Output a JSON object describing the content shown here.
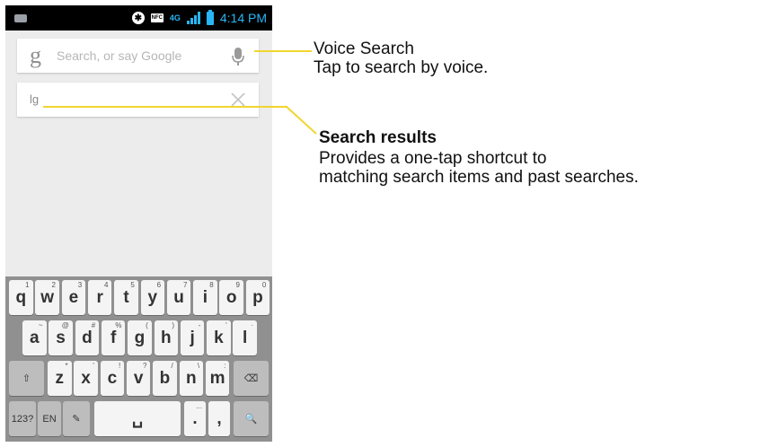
{
  "status_bar": {
    "time": "4:14 PM",
    "nfc_label": "NFC",
    "network_label": "4G",
    "bluetooth_glyph": "✱",
    "icons": [
      "keyboard-icon",
      "bluetooth-icon",
      "nfc-icon",
      "4g-icon",
      "signal-icon",
      "battery-icon"
    ]
  },
  "search": {
    "logo": "g",
    "placeholder": "Search, or say Google",
    "voice_icon": "microphone-icon"
  },
  "query": {
    "text": "lg",
    "clear_icon": "close-icon"
  },
  "keyboard": {
    "row1": [
      {
        "label": "q",
        "sup": "1"
      },
      {
        "label": "w",
        "sup": "2"
      },
      {
        "label": "e",
        "sup": "3"
      },
      {
        "label": "r",
        "sup": "4"
      },
      {
        "label": "t",
        "sup": "5"
      },
      {
        "label": "y",
        "sup": "6"
      },
      {
        "label": "u",
        "sup": "7"
      },
      {
        "label": "i",
        "sup": "8"
      },
      {
        "label": "o",
        "sup": "9"
      },
      {
        "label": "p",
        "sup": "0"
      }
    ],
    "row2": [
      {
        "label": "a",
        "sup": "~"
      },
      {
        "label": "s",
        "sup": "@"
      },
      {
        "label": "d",
        "sup": "#"
      },
      {
        "label": "f",
        "sup": "%"
      },
      {
        "label": "g",
        "sup": "("
      },
      {
        "label": "h",
        "sup": ")"
      },
      {
        "label": "j",
        "sup": "-"
      },
      {
        "label": "k",
        "sup": "'"
      },
      {
        "label": "l",
        "sup": "·"
      }
    ],
    "row3": [
      {
        "label": "z",
        "sup": "*"
      },
      {
        "label": "x",
        "sup": "'"
      },
      {
        "label": "c",
        "sup": "!"
      },
      {
        "label": "v",
        "sup": "?"
      },
      {
        "label": "b",
        "sup": "/"
      },
      {
        "label": "n",
        "sup": "\\"
      },
      {
        "label": "m",
        "sup": ":"
      }
    ],
    "shift_label": "⇧",
    "backspace_label": "⌫",
    "symbols_label": "123?",
    "language_label": "EN",
    "pen_label": "✎",
    "space_label": "␣",
    "period_label": ".",
    "period_sup": "...",
    "comma_label": ",",
    "search_key_label": "🔍"
  },
  "callouts": {
    "voice_title": "Voice Search",
    "voice_desc": "Tap to search by voice.",
    "results_title": "Search results",
    "results_desc_line1": "Provides a one-tap shortcut to",
    "results_desc_line2": "matching search items and past searches.",
    "line_color": "#f2d530"
  }
}
